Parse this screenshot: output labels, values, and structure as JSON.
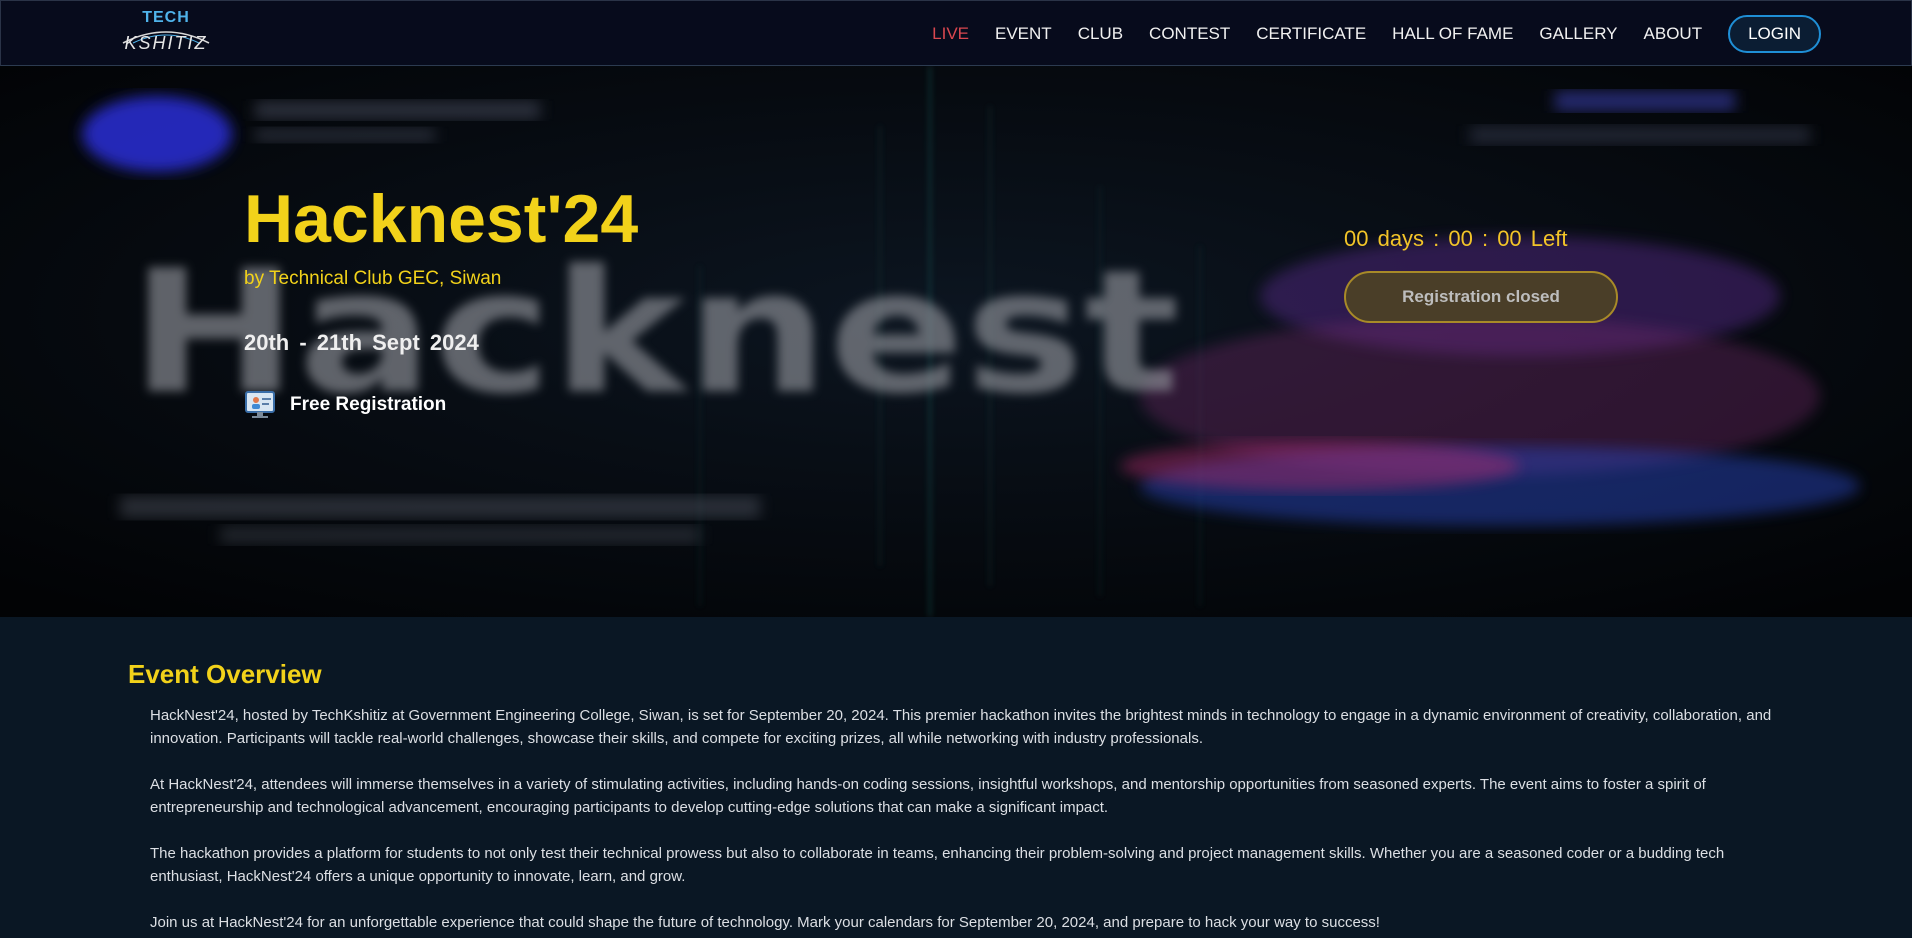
{
  "header": {
    "logo": {
      "top": "TECH",
      "bottom": "KSHITIZ"
    },
    "nav": [
      "LIVE",
      "EVENT",
      "CLUB",
      "CONTEST",
      "CERTIFICATE",
      "HALL OF FAME",
      "GALLERY",
      "ABOUT"
    ],
    "login_label": "LOGIN"
  },
  "hero": {
    "title": "Hacknest'24",
    "organizer": "by Technical Club GEC, Siwan",
    "date": "20th - 21th  Sept  2024",
    "registration_fee": "Free Registration",
    "background_text": "Hacknest",
    "countdown": "00 days : 00 : 00 Left",
    "registration_button": "Registration closed"
  },
  "overview": {
    "title": "Event Overview",
    "paragraphs": [
      "HackNest'24, hosted by TechKshitiz at Government Engineering College, Siwan, is set for September 20, 2024. This premier hackathon invites the brightest minds in technology to engage in a dynamic environment of creativity, collaboration, and innovation. Participants will tackle real-world challenges, showcase their skills, and compete for exciting prizes, all while networking with industry professionals.",
      "At HackNest'24, attendees will immerse themselves in a variety of stimulating activities, including hands-on coding sessions, insightful workshops, and mentorship opportunities from seasoned experts. The event aims to foster a spirit of entrepreneurship and technological advancement, encouraging participants to develop cutting-edge solutions that can make a significant impact.",
      "The hackathon provides a platform for students to not only test their technical prowess but also to collaborate in teams, enhancing their problem-solving and project management skills. Whether you are a seasoned coder or a budding tech enthusiast, HackNest'24 offers a unique opportunity to innovate, learn, and grow.",
      "Join us at HackNest'24 for an unforgettable experience that could shape the future of technology. Mark your calendars for September 20, 2024, and prepare to hack your way to success!"
    ]
  },
  "colors": {
    "accent_yellow": "#f2d21a",
    "live_red": "#d9474f",
    "login_border": "#1f8fd6",
    "navbar_bg": "#070b1c",
    "overview_bg": "#0a1724"
  }
}
